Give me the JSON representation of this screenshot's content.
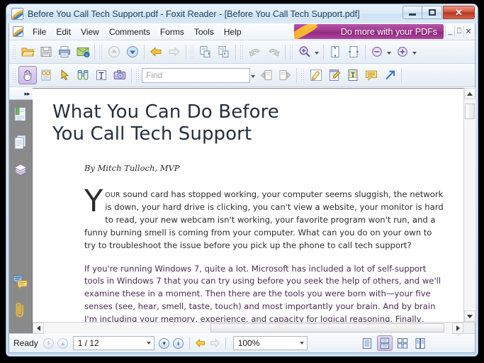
{
  "window": {
    "title": "Before You Call Tech Support.pdf - Foxit Reader - [Before You Call Tech Support.pdf]",
    "app_icon": "foxit-document-icon",
    "controls": {
      "minimize": "–",
      "maximize": "□",
      "close": "✕"
    }
  },
  "menubar": {
    "items": [
      "File",
      "Edit",
      "View",
      "Comments",
      "Forms",
      "Tools",
      "Help"
    ],
    "promo_text": "Do more with your PDFs",
    "mdi": {
      "minimize": "_",
      "restore": "❐",
      "close": "✕"
    }
  },
  "toolbar_row1": [
    {
      "name": "open-file-button",
      "icon": "open-folder-icon"
    },
    {
      "name": "save-button",
      "icon": "save-floppy-icon"
    },
    {
      "name": "print-button",
      "icon": "printer-icon"
    },
    {
      "name": "email-button",
      "icon": "email-envelope-icon"
    },
    {
      "name": "previous-page-button",
      "icon": "up-arrow-circle-icon"
    },
    {
      "name": "next-page-button",
      "icon": "down-arrow-circle-icon"
    },
    {
      "name": "previous-view-button",
      "icon": "back-arrow-icon"
    },
    {
      "name": "next-view-button",
      "icon": "forward-arrow-icon"
    },
    {
      "name": "first-page-button",
      "icon": "page-top-icon"
    },
    {
      "name": "last-page-button",
      "icon": "page-bottom-icon"
    },
    {
      "name": "undo-button",
      "icon": "undo-arrow-icon"
    },
    {
      "name": "redo-button",
      "icon": "redo-arrow-icon"
    },
    {
      "name": "marquee-zoom-button",
      "icon": "magnifier-plus-icon"
    },
    {
      "name": "fit-page-button",
      "icon": "fit-page-icon"
    },
    {
      "name": "fit-width-button",
      "icon": "fit-width-icon"
    },
    {
      "name": "zoom-out-button",
      "icon": "zoom-out-circle-icon"
    },
    {
      "name": "zoom-in-button",
      "icon": "zoom-in-circle-icon"
    }
  ],
  "toolbar_row2": [
    {
      "name": "hand-tool-button",
      "icon": "hand-icon",
      "active": true
    },
    {
      "name": "reading-mode-button",
      "icon": "glasses-icon"
    },
    {
      "name": "select-annotation-button",
      "icon": "arrow-cursor-icon"
    },
    {
      "name": "zoom-tool-button",
      "icon": "binoculars-icon"
    },
    {
      "name": "select-text-button",
      "icon": "text-select-icon"
    },
    {
      "name": "snapshot-button",
      "icon": "camera-icon"
    },
    {
      "name": "find-previous-button",
      "icon": "find-previous-icon"
    },
    {
      "name": "find-next-button",
      "icon": "find-next-icon"
    },
    {
      "name": "highlight-button",
      "icon": "highlighter-icon"
    },
    {
      "name": "pencil-button",
      "icon": "pencil-note-icon"
    },
    {
      "name": "typewriter-button",
      "icon": "typewriter-icon"
    },
    {
      "name": "note-button",
      "icon": "sticky-note-icon"
    },
    {
      "name": "link-button",
      "icon": "arrow-link-icon"
    }
  ],
  "find": {
    "placeholder": "Find",
    "value": ""
  },
  "sidebar": {
    "expand_glyph": "▸▸",
    "items": [
      {
        "name": "sidebar-item-bookmarks",
        "icon": "bookmark-page-icon"
      },
      {
        "name": "sidebar-item-pages",
        "icon": "page-thumbnails-icon"
      },
      {
        "name": "sidebar-item-layers",
        "icon": "layers-icon"
      },
      {
        "name": "sidebar-item-comments",
        "icon": "comments-icon"
      },
      {
        "name": "sidebar-item-attachments",
        "icon": "paperclip-icon"
      }
    ]
  },
  "document": {
    "title": "What You Can Do Before\nYou Call Tech Support",
    "title_line1": "What You Can Do Before",
    "title_line2": "You Call Tech Support",
    "byline": "By Mitch Tulloch, MVP",
    "dropcap": "Y",
    "para1_smallcaps": "OUR",
    "para1": " sound card has stopped working, your computer seems sluggish, the network is down, your hard drive is clicking, you can't view a website, your monitor is hard to read, your new webcam isn't working, your favorite program won't run, and a funny burning smell is coming from your computer. What can you do on your own to try to troubleshoot the issue before you pick up the phone to call tech support?",
    "para2": "If you're running Windows 7, quite a lot. Microsoft has included a lot of self-support tools in Windows 7 that you can try using before you seek the help of others, and we'll examine these in a moment. Then there are the tools you were born with—your five senses (see, hear, smell, taste, touch) and most importantly your brain. And by brain I'm including your memory, experience, and capacity for logical reasoning. Finally, there is ancient and sacred"
  },
  "statusbar": {
    "status": "Ready",
    "page_value": "1 / 12",
    "zoom_value": "100%",
    "buttons": [
      {
        "name": "first-page-status-button",
        "icon": "first-page-icon"
      },
      {
        "name": "previous-page-status-button",
        "icon": "previous-page-icon"
      },
      {
        "name": "next-page-status-button",
        "icon": "next-page-icon"
      },
      {
        "name": "last-page-status-button",
        "icon": "last-page-icon"
      },
      {
        "name": "previous-view-status-button",
        "icon": "back-arrow-icon"
      },
      {
        "name": "next-view-status-button",
        "icon": "forward-arrow-icon"
      }
    ],
    "view_modes": [
      {
        "name": "single-page-view-button",
        "icon": "single-page-icon",
        "active": false
      },
      {
        "name": "continuous-view-button",
        "icon": "continuous-page-icon",
        "active": true
      },
      {
        "name": "facing-view-button",
        "icon": "facing-pages-icon",
        "active": false
      },
      {
        "name": "continuous-facing-view-button",
        "icon": "continuous-facing-icon",
        "active": false
      }
    ]
  },
  "colors": {
    "promo_purple": "#a0368f",
    "accent_active": "#cdbce8",
    "titlebar_text": "#123a63",
    "doc_background": "#808080"
  }
}
